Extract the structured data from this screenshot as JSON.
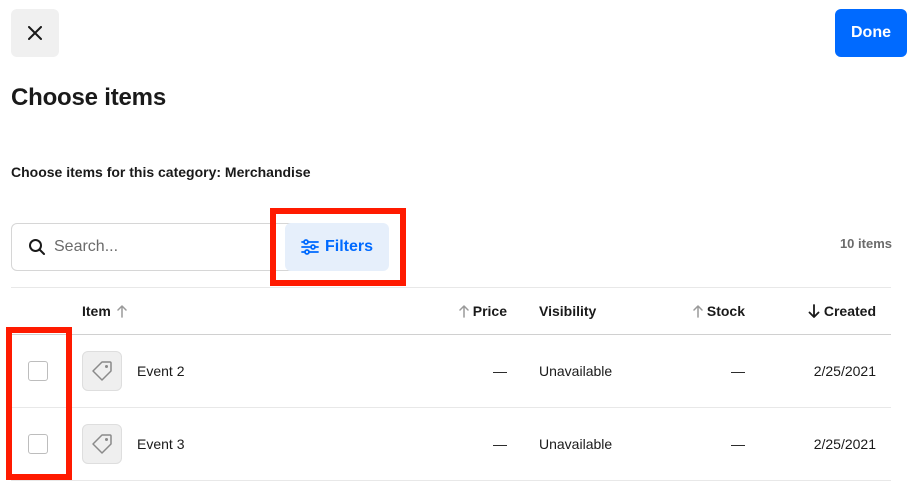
{
  "header": {
    "close_icon": "close-icon",
    "done_label": "Done"
  },
  "page": {
    "title": "Choose items",
    "subtitle": "Choose items for this category: Merchandise"
  },
  "toolbar": {
    "search_placeholder": "Search...",
    "filters_label": "Filters",
    "item_count": "10 items"
  },
  "table": {
    "columns": {
      "item": "Item",
      "price": "Price",
      "visibility": "Visibility",
      "stock": "Stock",
      "created": "Created"
    },
    "rows": [
      {
        "name": "Event 2",
        "price": "—",
        "visibility": "Unavailable",
        "stock": "—",
        "created": "2/25/2021"
      },
      {
        "name": "Event 3",
        "price": "—",
        "visibility": "Unavailable",
        "stock": "—",
        "created": "2/25/2021"
      }
    ]
  },
  "colors": {
    "accent": "#006aff",
    "highlight": "#ff1a00",
    "filters_bg": "#e6effb"
  }
}
